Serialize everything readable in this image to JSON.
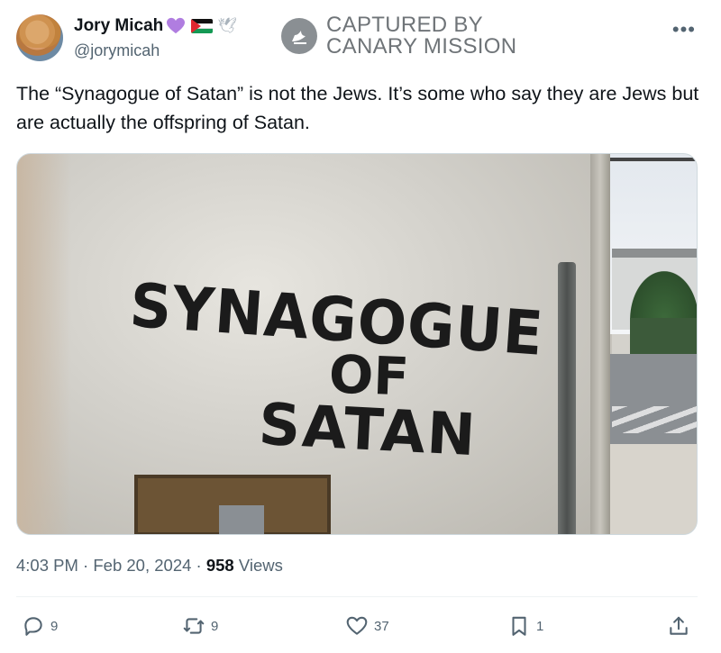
{
  "author": {
    "name": "Jory Micah",
    "handle": "@jorymicah",
    "emoji_icons": [
      "purple-heart-icon",
      "palestine-flag-icon",
      "dove-icon"
    ]
  },
  "watermark": {
    "line1": "CAPTURED BY",
    "line2": "CANARY MISSION"
  },
  "more_label": "•••",
  "tweet": {
    "text": "The “Synagogue of Satan” is not the Jews. It’s some who say they are Jews but are actually the offspring of Satan."
  },
  "image": {
    "graffiti_line1": "SYNAGOGUE",
    "graffiti_line2": "OF",
    "graffiti_line3": "SATAN"
  },
  "meta": {
    "time": "4:03 PM",
    "sep1": "·",
    "date": "Feb 20, 2024",
    "sep2": "·",
    "views_count": "958",
    "views_label": "Views"
  },
  "actions": {
    "replies": "9",
    "reposts": "9",
    "likes": "37",
    "bookmarks": "1"
  },
  "colors": {
    "text": "#0f1419",
    "secondary": "#536471",
    "heart": "#b07de0"
  }
}
